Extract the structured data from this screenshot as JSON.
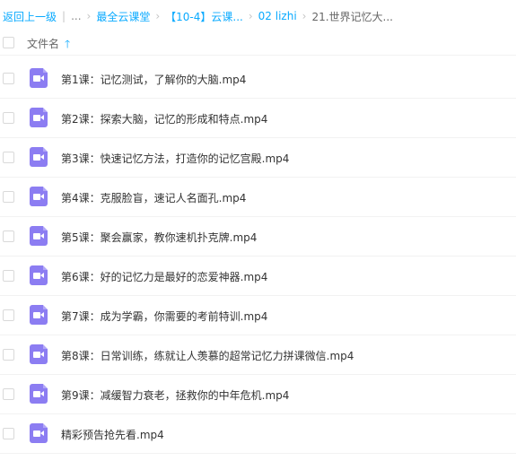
{
  "breadcrumb": {
    "back": "返回上一级",
    "ellipsis": "...",
    "items": [
      "最全云课堂",
      "【10-4】云课...",
      "02 lizhi"
    ],
    "current": "21.世界记忆大..."
  },
  "header": {
    "column_name": "文件名",
    "sort_icon": "arrow-up-icon"
  },
  "files": [
    {
      "name": "第1课：记忆测试，了解你的大脑.mp4",
      "icon": "video-file-icon"
    },
    {
      "name": "第2课：探索大脑，记忆的形成和特点.mp4",
      "icon": "video-file-icon"
    },
    {
      "name": "第3课：快速记忆方法，打造你的记忆宫殿.mp4",
      "icon": "video-file-icon"
    },
    {
      "name": "第4课：克服脸盲，速记人名面孔.mp4",
      "icon": "video-file-icon"
    },
    {
      "name": "第5课：聚会赢家，教你速机扑克牌.mp4",
      "icon": "video-file-icon"
    },
    {
      "name": "第6课：好的记忆力是最好的恋爱神器.mp4",
      "icon": "video-file-icon"
    },
    {
      "name": "第7课：成为学霸，你需要的考前特训.mp4",
      "icon": "video-file-icon"
    },
    {
      "name": "第8课：日常训练，练就让人羡慕的超常记忆力拼课微信.mp4",
      "icon": "video-file-icon"
    },
    {
      "name": "第9课：减缓智力衰老，拯救你的中年危机.mp4",
      "icon": "video-file-icon"
    },
    {
      "name": "精彩预告抢先看.mp4",
      "icon": "video-file-icon"
    }
  ],
  "colors": {
    "link": "#09aaff",
    "video_icon": "#8c7df2"
  }
}
